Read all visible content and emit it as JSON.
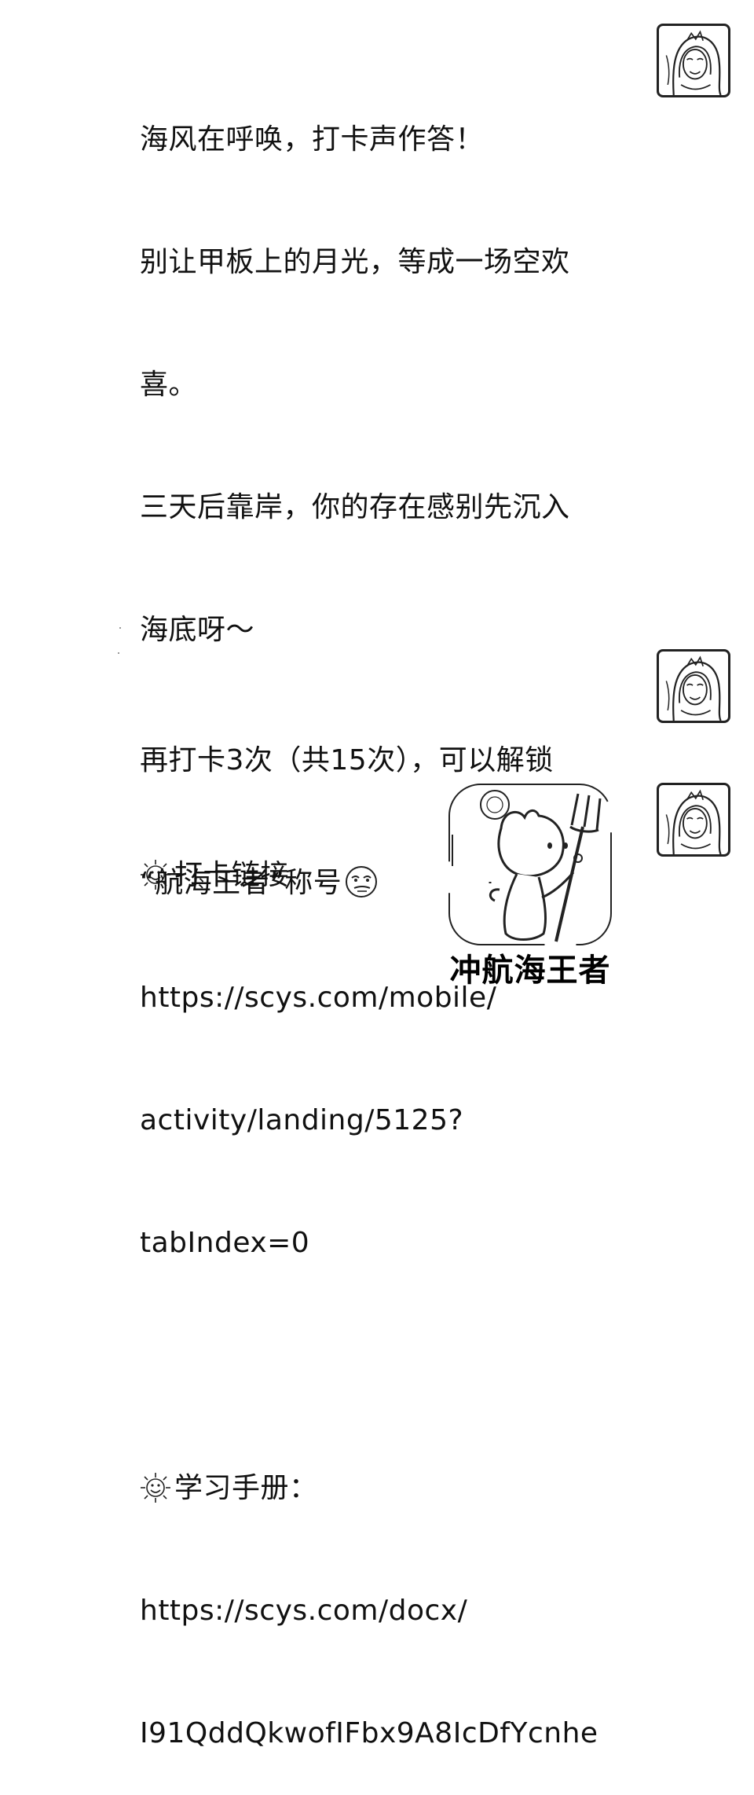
{
  "chat": {
    "message1": {
      "lines": [
        "海风在呼唤，打卡声作答！",
        "别让甲板上的月光，等成一场空欢",
        "喜。",
        "三天后靠岸，你的存在感别先沉入",
        "海底呀～",
        "",
        "打卡链接",
        "https://scys.com/mobile/",
        "activity/landing/5125?",
        "tabIndex=0",
        "",
        "学习手册：",
        "https://scys.com/docx/",
        "I91QddQkwofIFbx9A8IcDfYcnhe"
      ],
      "icons": [
        "sun-emoji-icon",
        "sun-emoji-icon"
      ]
    },
    "message2": {
      "lines": [
        "再打卡3次（共15次），可以解锁",
        "“航海王者”称号"
      ],
      "icon": "smirk-emoji-icon"
    },
    "sticker": {
      "caption": "冲航海王者",
      "icon": "trident-cat-sticker"
    },
    "avatars": [
      "mermaid-avatar-icon",
      "mermaid-avatar-icon",
      "mermaid-avatar-icon"
    ]
  }
}
